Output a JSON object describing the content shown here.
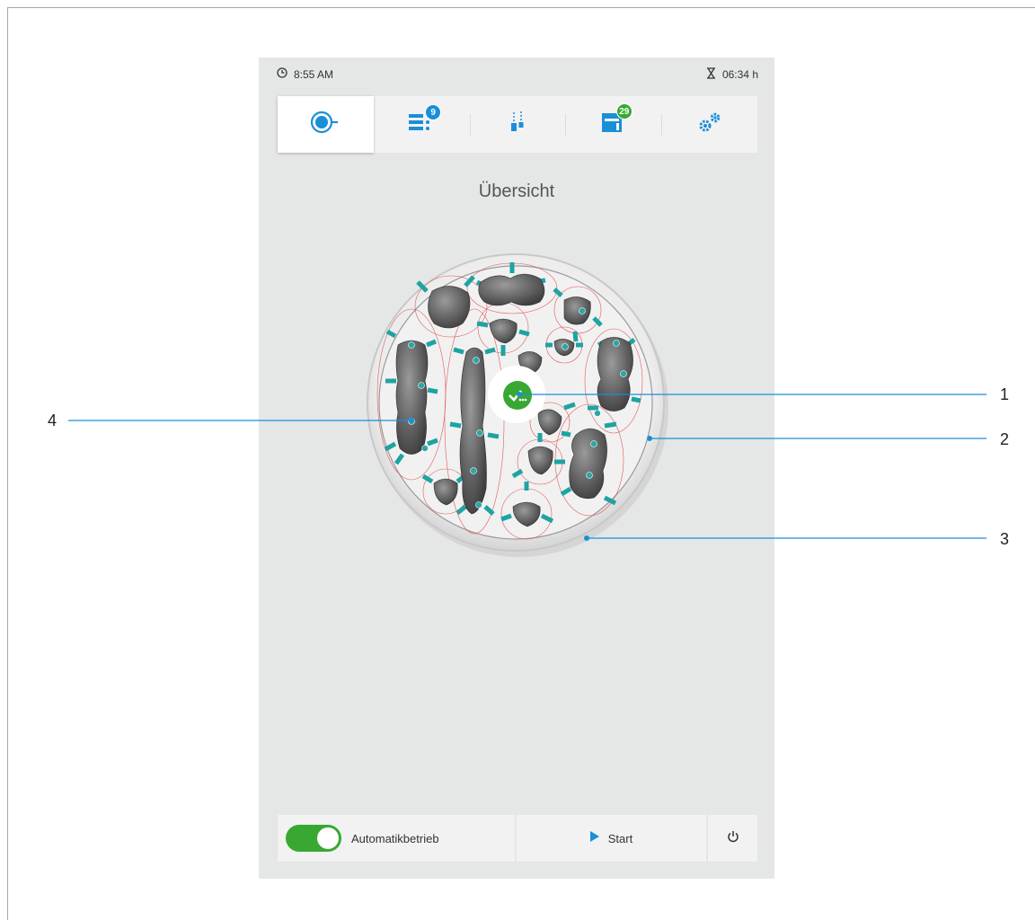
{
  "status_bar": {
    "time": "8:55 AM",
    "remaining_time": "06:34 h",
    "clock_icon": "clock-icon",
    "hourglass_icon": "hourglass-icon"
  },
  "tabs": [
    {
      "icon": "overview-icon",
      "active": true
    },
    {
      "icon": "job-list-icon",
      "badge": "9",
      "badge_color": "#1a8fd8"
    },
    {
      "icon": "tools-icon"
    },
    {
      "icon": "material-magazine-icon",
      "badge": "29",
      "badge_color": "#38a832"
    },
    {
      "icon": "settings-gears-icon"
    }
  ],
  "page_title": "Übersicht",
  "disc": {
    "status_icon": "job-status-check-icon",
    "status_color": "#38a832"
  },
  "bottom_bar": {
    "auto_mode_label": "Automatikbetrieb",
    "auto_mode_on": true,
    "start_label": "Start",
    "power_icon": "power-icon"
  },
  "callouts": [
    "1",
    "2",
    "3",
    "4"
  ],
  "colors": {
    "accent": "#1a8fd8",
    "success": "#38a832",
    "holder": "#1ea3a3"
  }
}
